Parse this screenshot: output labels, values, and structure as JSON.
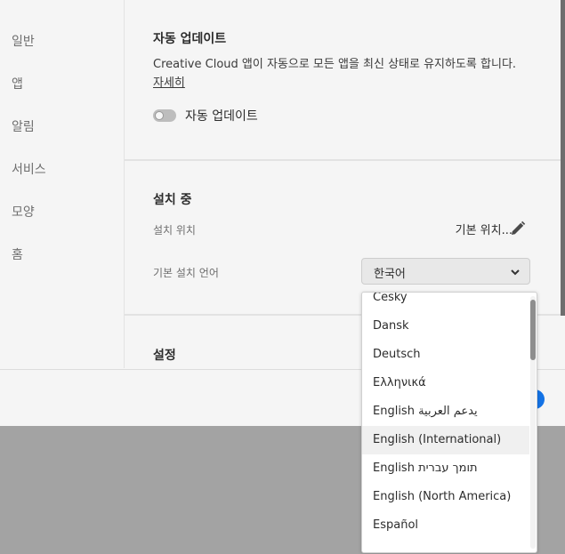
{
  "sidebar": {
    "items": [
      {
        "label": "일반"
      },
      {
        "label": "앱"
      },
      {
        "label": "알림"
      },
      {
        "label": "서비스"
      },
      {
        "label": "모양"
      },
      {
        "label": "홈"
      }
    ]
  },
  "auto_update": {
    "heading": "자동 업데이트",
    "description": "Creative Cloud 앱이 자동으로 모든 앱을 최신 상태로 유지하도록 합니다.",
    "learn_more": "자세히",
    "toggle_label": "자동 업데이트",
    "toggle_on": false
  },
  "installing": {
    "heading": "설치 중",
    "location_label": "설치 위치",
    "location_value": "기본 위치...",
    "language_label": "기본 설치 언어",
    "language_value": "한국어"
  },
  "settings": {
    "heading": "설정"
  },
  "language_options": [
    {
      "label": "Česky"
    },
    {
      "label": "Dansk"
    },
    {
      "label": "Deutsch"
    },
    {
      "label": "Ελληνικά"
    },
    {
      "label": "English يدعم العربية"
    },
    {
      "label": "English (International)"
    },
    {
      "label": "English תומך עברית"
    },
    {
      "label": "English (North America)"
    },
    {
      "label": "Español"
    }
  ],
  "colors": {
    "accent": "#1473e6",
    "overlay": "#a3a3a3"
  }
}
